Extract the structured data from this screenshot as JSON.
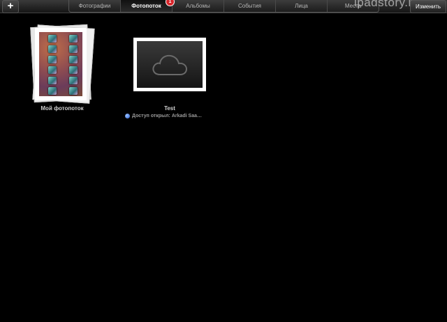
{
  "toolbar": {
    "add_label": "+",
    "edit_label": "Изменить",
    "watermark": "ipadstory.ru",
    "badge_count": "1",
    "tabs": [
      {
        "label": "Фотографии",
        "active": false
      },
      {
        "label": "Фотопоток",
        "active": true
      },
      {
        "label": "Альбомы",
        "active": false
      },
      {
        "label": "События",
        "active": false
      },
      {
        "label": "Лица",
        "active": false
      },
      {
        "label": "Места",
        "active": false
      }
    ]
  },
  "albums": [
    {
      "title": "Мой фотопоток",
      "cover": "photo-stack"
    },
    {
      "title": "Test",
      "cover": "cloud-icon",
      "shared_text": "Доступ открыл: Arkadi Saa…"
    }
  ],
  "colors": {
    "background": "#000000",
    "active_tab_text": "#ffffff",
    "badge": "#d8262b",
    "shared_dot": "#2a5fd0"
  }
}
